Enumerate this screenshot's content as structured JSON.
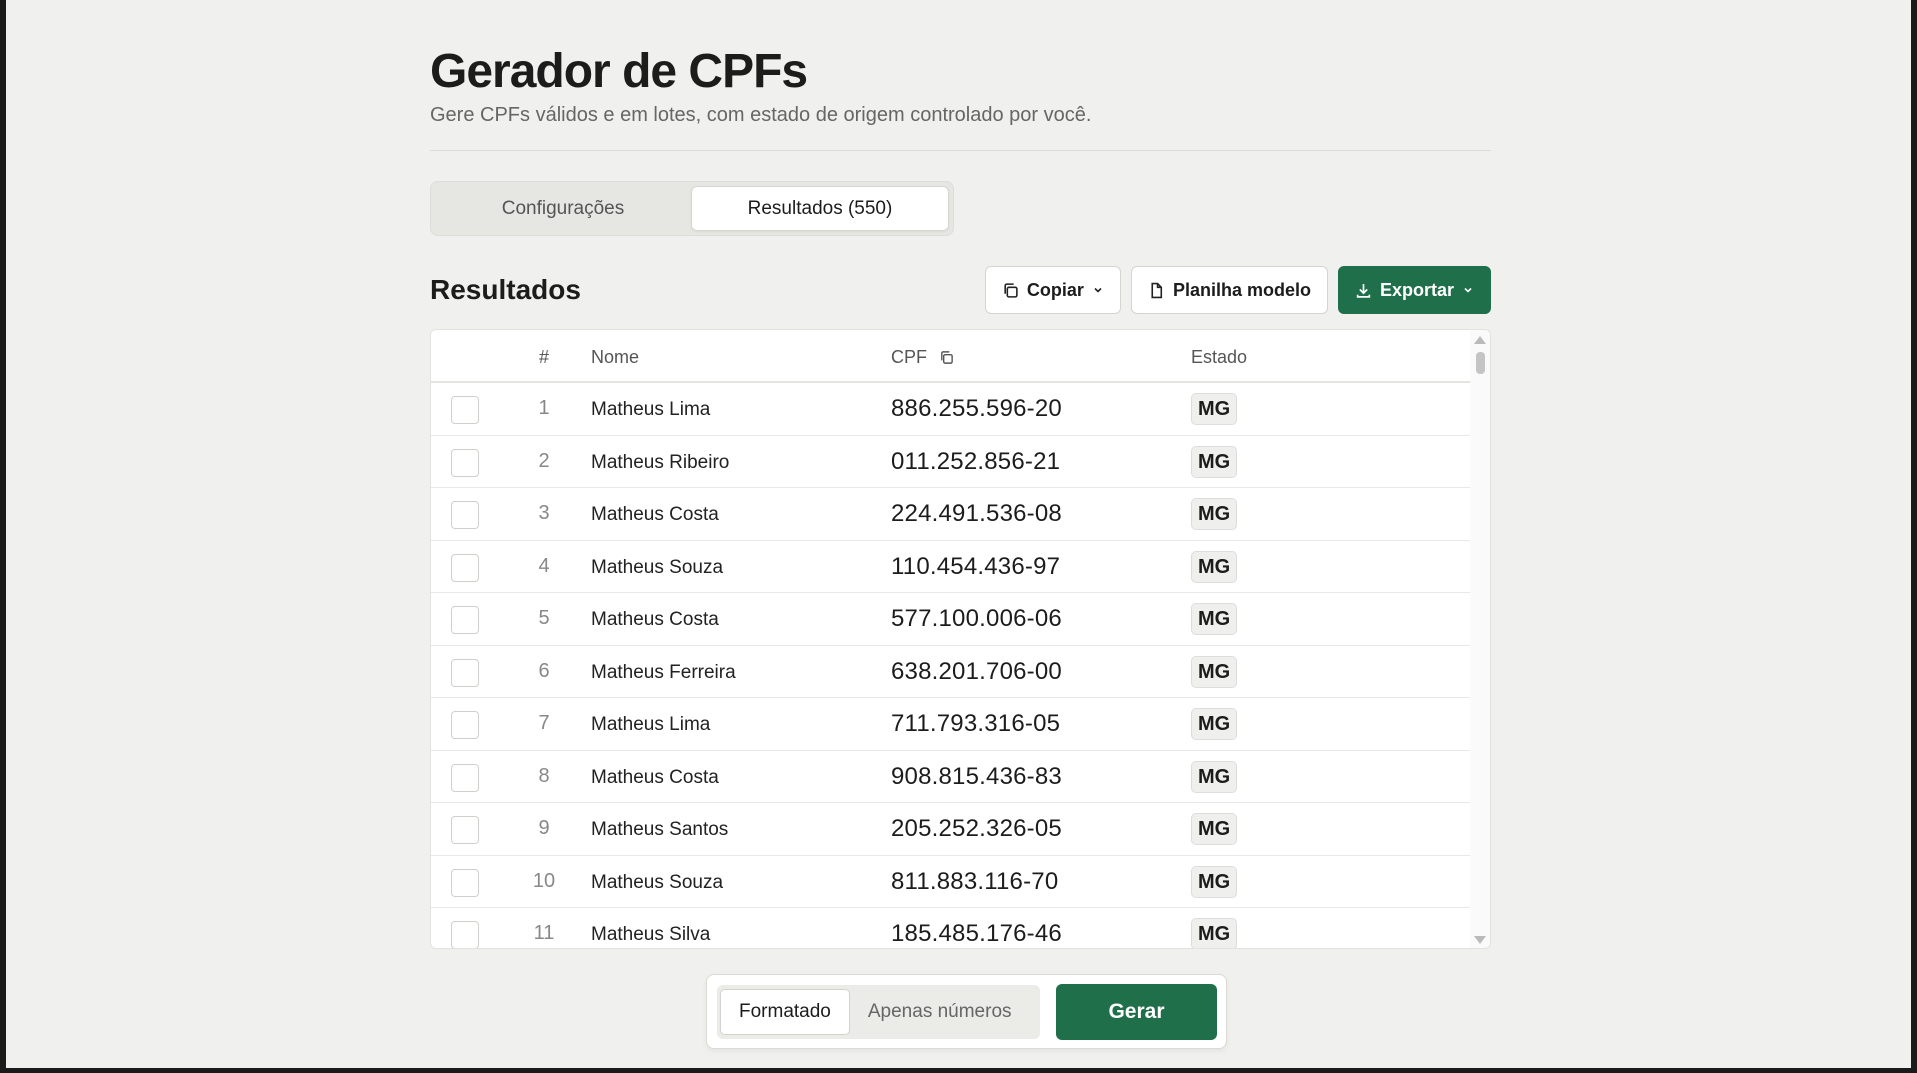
{
  "header": {
    "title": "Gerador de CPFs",
    "subtitle": "Gere CPFs válidos e em lotes, com estado de origem controlado por você."
  },
  "tabs": [
    {
      "label": "Configurações",
      "active": false
    },
    {
      "label": "Resultados (550)",
      "active": true
    }
  ],
  "results": {
    "title": "Resultados",
    "copy_label": "Copiar",
    "template_label": "Planilha modelo",
    "export_label": "Exportar"
  },
  "table": {
    "columns": {
      "num": "#",
      "nome": "Nome",
      "cpf": "CPF",
      "estado": "Estado"
    },
    "rows": [
      {
        "num": "1",
        "nome": "Matheus Lima",
        "cpf": "886.255.596-20",
        "estado": "MG"
      },
      {
        "num": "2",
        "nome": "Matheus Ribeiro",
        "cpf": "011.252.856-21",
        "estado": "MG"
      },
      {
        "num": "3",
        "nome": "Matheus Costa",
        "cpf": "224.491.536-08",
        "estado": "MG"
      },
      {
        "num": "4",
        "nome": "Matheus Souza",
        "cpf": "110.454.436-97",
        "estado": "MG"
      },
      {
        "num": "5",
        "nome": "Matheus Costa",
        "cpf": "577.100.006-06",
        "estado": "MG"
      },
      {
        "num": "6",
        "nome": "Matheus Ferreira",
        "cpf": "638.201.706-00",
        "estado": "MG"
      },
      {
        "num": "7",
        "nome": "Matheus Lima",
        "cpf": "711.793.316-05",
        "estado": "MG"
      },
      {
        "num": "8",
        "nome": "Matheus Costa",
        "cpf": "908.815.436-83",
        "estado": "MG"
      },
      {
        "num": "9",
        "nome": "Matheus Santos",
        "cpf": "205.252.326-05",
        "estado": "MG"
      },
      {
        "num": "10",
        "nome": "Matheus Souza",
        "cpf": "811.883.116-70",
        "estado": "MG"
      },
      {
        "num": "11",
        "nome": "Matheus Silva",
        "cpf": "185.485.176-46",
        "estado": "MG"
      }
    ]
  },
  "bottom": {
    "format_formatted": "Formatado",
    "format_numbers": "Apenas números",
    "generate_label": "Gerar"
  },
  "colors": {
    "primary": "#1f6f4a",
    "background": "#f0f0ee"
  }
}
